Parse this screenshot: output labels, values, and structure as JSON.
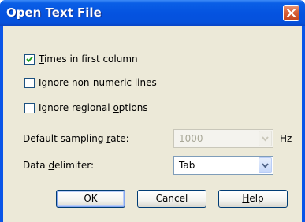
{
  "window": {
    "title": "Open Text File"
  },
  "checkboxes": [
    {
      "label_accel": "T",
      "label_rest": "imes in first column",
      "checked": true
    },
    {
      "label_pre": "Ignore ",
      "label_accel": "n",
      "label_rest": "on-numeric lines",
      "checked": false
    },
    {
      "label_pre": "Ignore regional ",
      "label_accel": "o",
      "label_rest": "ptions",
      "checked": false
    }
  ],
  "sampling": {
    "label_pre": "Default sampling ",
    "label_accel": "r",
    "label_rest": "ate:",
    "value": "1000",
    "unit": "Hz",
    "enabled": false
  },
  "delimiter": {
    "label_pre": "Data ",
    "label_accel": "d",
    "label_rest": "elimiter:",
    "value": "Tab"
  },
  "buttons": {
    "ok": "OK",
    "cancel": "Cancel",
    "help_accel": "H",
    "help_rest": "elp"
  },
  "icons": {
    "close": "close-icon",
    "check": "check-icon",
    "dropdown": "chevron-down-icon"
  },
  "colors": {
    "titlebar": "#0553e0",
    "close_button": "#d9643c",
    "dialog_bg": "#ece9d8",
    "checkmark": "#21a121"
  }
}
